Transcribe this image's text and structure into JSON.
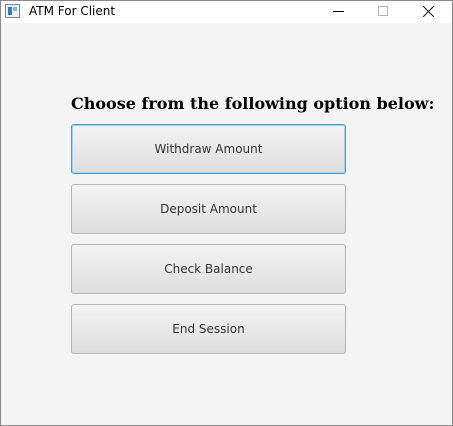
{
  "window": {
    "title": "ATM For Client",
    "icon": "app-window-icon"
  },
  "titlebar_controls": {
    "minimize_icon": "minimize-icon",
    "maximize_icon": "maximize-icon",
    "close_icon": "close-icon"
  },
  "menu": {
    "prompt": "Choose from the following option below:",
    "options": [
      {
        "label": "Withdraw Amount"
      },
      {
        "label": "Deposit Amount"
      },
      {
        "label": "Check Balance"
      },
      {
        "label": "End Session"
      }
    ],
    "focused_option": "Withdraw Amount"
  },
  "colors": {
    "window_bg": "#f4f4f4",
    "focus_border": "#3c9ed8"
  }
}
